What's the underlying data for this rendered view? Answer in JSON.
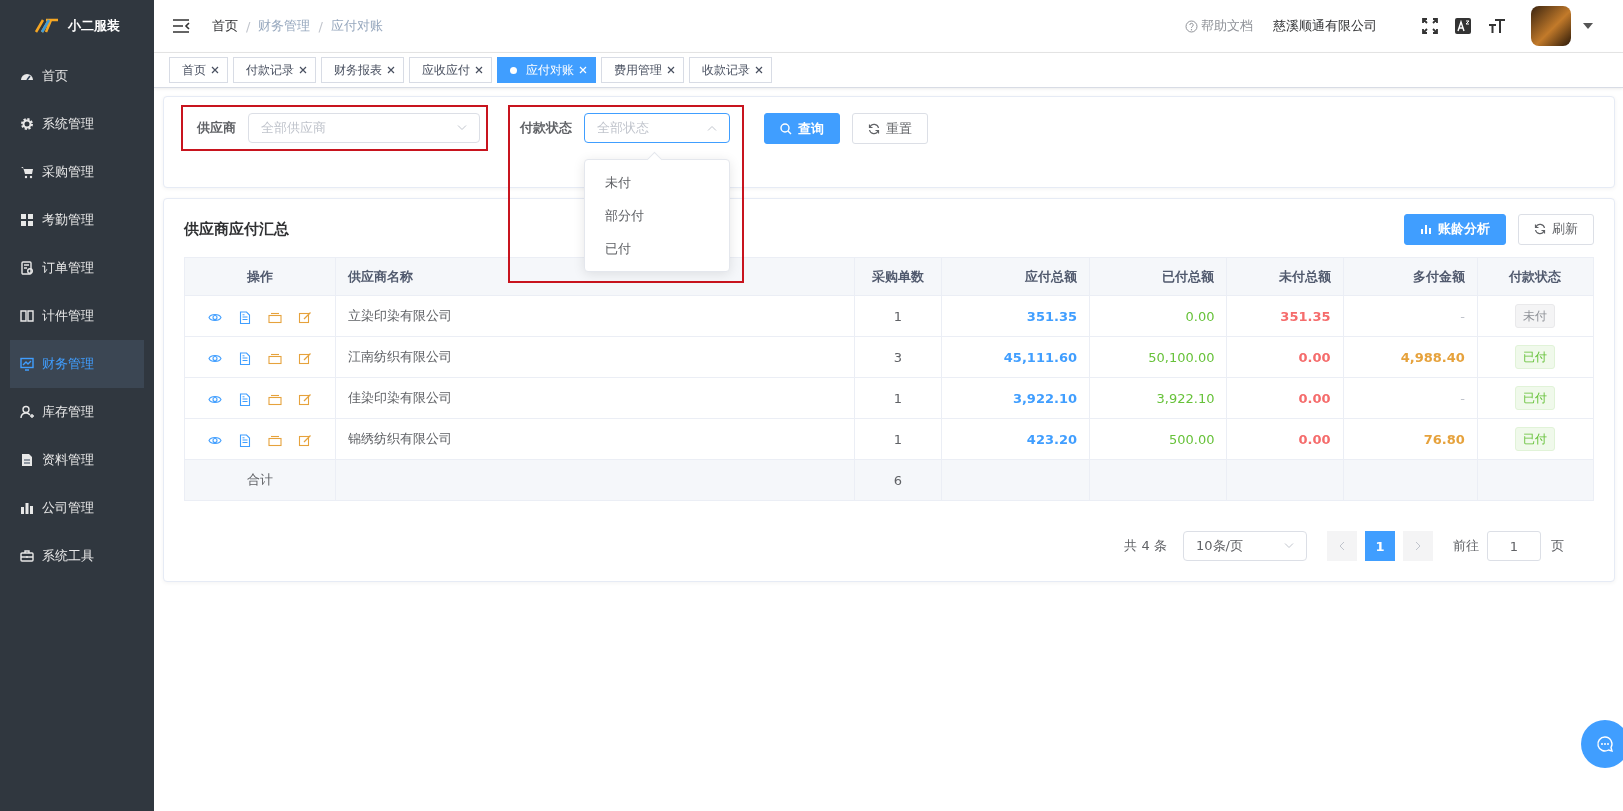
{
  "app": {
    "logo_text": "小二服装"
  },
  "sidebar": {
    "items": [
      {
        "label": "首页",
        "selected": false
      },
      {
        "label": "系统管理",
        "selected": false
      },
      {
        "label": "采购管理",
        "selected": false
      },
      {
        "label": "考勤管理",
        "selected": false
      },
      {
        "label": "订单管理",
        "selected": false
      },
      {
        "label": "计件管理",
        "selected": false
      },
      {
        "label": "财务管理",
        "selected": true
      },
      {
        "label": "库存管理",
        "selected": false
      },
      {
        "label": "资料管理",
        "selected": false
      },
      {
        "label": "公司管理",
        "selected": false
      },
      {
        "label": "系统工具",
        "selected": false
      }
    ]
  },
  "header": {
    "breadcrumbs": [
      {
        "text": "首页",
        "kind": "home"
      },
      {
        "text": "/",
        "kind": "separator"
      },
      {
        "text": "财务管理",
        "kind": "link"
      },
      {
        "text": "/",
        "kind": "separator"
      },
      {
        "text": "应付对账",
        "kind": "current"
      }
    ],
    "help": "帮助文档",
    "company": "慈溪顺通有限公司"
  },
  "tabs": [
    {
      "label": "首页",
      "selected": false
    },
    {
      "label": "付款记录",
      "selected": false
    },
    {
      "label": "财务报表",
      "selected": false
    },
    {
      "label": "应收应付",
      "selected": false
    },
    {
      "label": "应付对账",
      "selected": true
    },
    {
      "label": "费用管理",
      "selected": false
    },
    {
      "label": "收款记录",
      "selected": false
    }
  ],
  "filters": [
    {
      "label": "供应商",
      "placeholder": "全部供应商",
      "expanded": false,
      "highlighted": true
    },
    {
      "label": "付款状态",
      "placeholder": "全部状态",
      "expanded": true,
      "highlighted": true,
      "options": [
        "未付",
        "部分付",
        "已付"
      ]
    }
  ],
  "filter_buttons": [
    {
      "label": "查询",
      "kind": "primary"
    },
    {
      "label": "重置",
      "kind": "default"
    }
  ],
  "summary": {
    "title": "供应商应付汇总",
    "buttons": [
      {
        "label": "账龄分析",
        "kind": "primary"
      },
      {
        "label": "刷新",
        "kind": "default"
      }
    ],
    "table": {
      "columns": [
        "操作",
        "供应商名称",
        "采购单数",
        "应付总额",
        "已付总额",
        "未付总额",
        "多付金额",
        "付款状态"
      ],
      "rows": [
        {
          "supplier": "立染印染有限公司",
          "orders": "1",
          "payable": "351.35",
          "paid": "0.00",
          "unpaid": "351.35",
          "overpaid": "-",
          "status": {
            "label": "未付",
            "kind": "unpaid"
          }
        },
        {
          "supplier": "江南纺织有限公司",
          "orders": "3",
          "payable": "45,111.60",
          "paid": "50,100.00",
          "unpaid": "0.00",
          "overpaid": "4,988.40",
          "status": {
            "label": "已付",
            "kind": "paid"
          }
        },
        {
          "supplier": "佳染印染有限公司",
          "orders": "1",
          "payable": "3,922.10",
          "paid": "3,922.10",
          "unpaid": "0.00",
          "overpaid": "-",
          "status": {
            "label": "已付",
            "kind": "paid"
          }
        },
        {
          "supplier": "锦绣纺织有限公司",
          "orders": "1",
          "payable": "423.20",
          "paid": "500.00",
          "unpaid": "0.00",
          "overpaid": "76.80",
          "status": {
            "label": "已付",
            "kind": "paid"
          }
        }
      ],
      "total_row": {
        "label": "合计",
        "orders": "6"
      }
    },
    "pagination": {
      "total": "共 4 条",
      "page_size": "10条/页",
      "pages": [
        {
          "label": "1",
          "selected": true
        }
      ],
      "goto_label": "前往",
      "goto_value": "1",
      "goto_suffix": "页"
    }
  }
}
